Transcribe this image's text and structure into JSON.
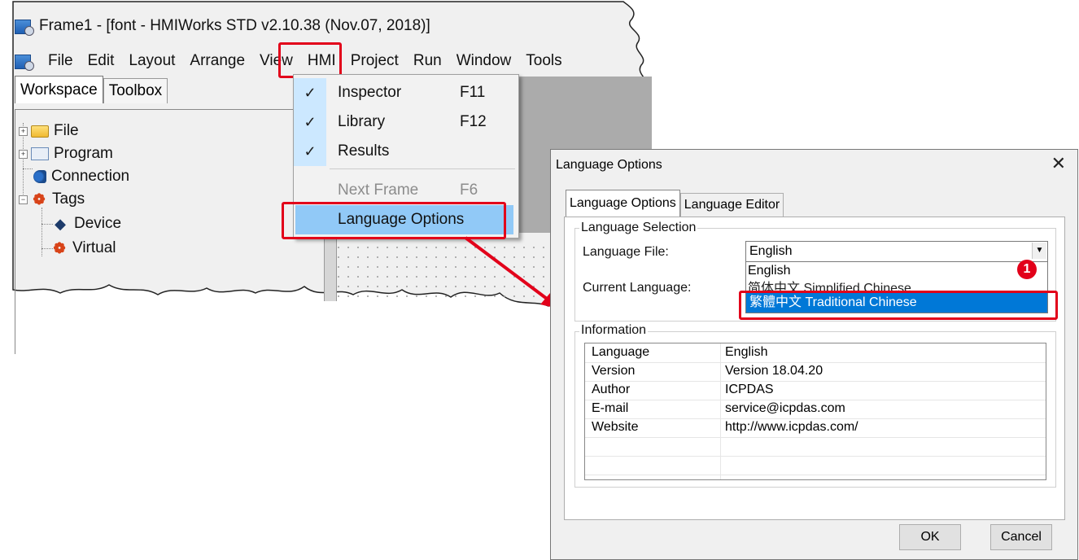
{
  "window": {
    "title": "Frame1 - [font - HMIWorks STD v2.10.38 (Nov.07, 2018)]"
  },
  "menu_bar": {
    "items": [
      "File",
      "Edit",
      "Layout",
      "Arrange",
      "View",
      "HMI",
      "Project",
      "Run",
      "Window",
      "Tools"
    ]
  },
  "workspace": {
    "tabs": [
      "Workspace",
      "Toolbox"
    ],
    "tree": [
      "File",
      "Program",
      "Connection",
      "Tags",
      "Device",
      "Virtual"
    ]
  },
  "view_menu": {
    "items": [
      {
        "label": "Inspector",
        "shortcut": "F11",
        "checked": true
      },
      {
        "label": "Library",
        "shortcut": "F12",
        "checked": true
      },
      {
        "label": "Results",
        "shortcut": "",
        "checked": true
      },
      {
        "label": "Next Frame",
        "shortcut": "F6",
        "checked": false,
        "disabled": true
      },
      {
        "label": "Language Options",
        "shortcut": "",
        "checked": false,
        "highlighted": true
      }
    ]
  },
  "dialog": {
    "title": "Language Options",
    "close_glyph": "✕",
    "tabs": [
      "Language Options",
      "Language Editor"
    ],
    "language_selection": {
      "group_label": "Language Selection",
      "file_label": "Language File:",
      "file_value": "English",
      "current_label": "Current Language:",
      "options": [
        "English",
        "简体中文 Simplified Chinese",
        "繁體中文 Traditional Chinese"
      ],
      "selected_option": "繁體中文 Traditional Chinese",
      "step_badge": "1"
    },
    "information": {
      "group_label": "Information",
      "rows": [
        {
          "key": "Language",
          "value": "English"
        },
        {
          "key": "Version",
          "value": "Version 18.04.20"
        },
        {
          "key": "Author",
          "value": "ICPDAS"
        },
        {
          "key": "E-mail",
          "value": "service@icpdas.com"
        },
        {
          "key": "Website",
          "value": "http://www.icpdas.com/"
        }
      ]
    },
    "ok_label": "OK",
    "cancel_label": "Cancel"
  },
  "colors": {
    "highlight_red": "#e2001a",
    "menu_hover": "#91c9f7",
    "selection_blue": "#0078d7"
  }
}
